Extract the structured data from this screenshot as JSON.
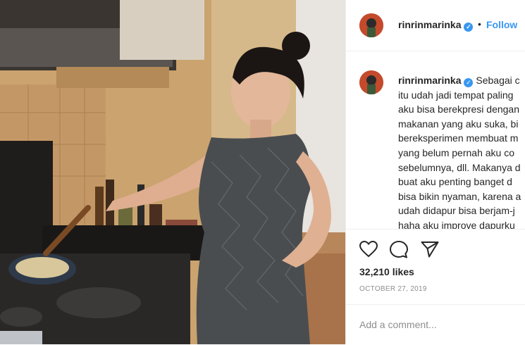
{
  "post": {
    "username": "rinrinmarinka",
    "follow_label": "Follow",
    "separator": "•",
    "caption_lines": [
      "Sebagai c",
      "itu udah jadi tempat paling",
      "aku bisa berekpresi dengan",
      "makanan yang aku suka, bi",
      "bereksperimen membuat m",
      "yang belum pernah aku co",
      "sebelumnya, dll. Makanya d",
      "buat aku penting banget d",
      "bisa bikin nyaman, karena a",
      "udah didapur bisa berjam-j",
      "haha aku improve dapurku"
    ],
    "likes": "32,210 likes",
    "date": "OCTOBER 27, 2019",
    "comment_placeholder": "Add a comment..."
  },
  "icons": {
    "like": "heart-icon",
    "comment": "comment-icon",
    "share": "share-icon",
    "verified": "verified-badge-icon"
  },
  "colors": {
    "accent": "#3897f0",
    "text": "#262626",
    "muted": "#8e8e8e"
  }
}
